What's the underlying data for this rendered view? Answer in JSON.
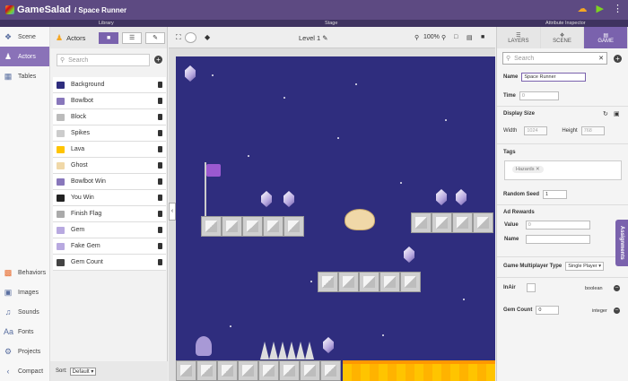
{
  "app": {
    "name": "GameSalad",
    "project": "/ Space Runner"
  },
  "sections": {
    "library": "Library",
    "stage": "Stage",
    "inspector": "Attribute Inspector"
  },
  "nav": {
    "top": [
      {
        "label": "Scene"
      },
      {
        "label": "Actors"
      },
      {
        "label": "Tables"
      }
    ],
    "bottom": [
      {
        "label": "Behaviors"
      },
      {
        "label": "Images"
      },
      {
        "label": "Sounds"
      },
      {
        "label": "Fonts"
      },
      {
        "label": "Projects"
      },
      {
        "label": "Compact"
      }
    ]
  },
  "library": {
    "title": "Actors",
    "search_placeholder": "Search",
    "actors": [
      {
        "name": "Background",
        "color": "#2f2d7e"
      },
      {
        "name": "Bowlbot",
        "color": "#8877bb"
      },
      {
        "name": "Block",
        "color": "#bbbbbb"
      },
      {
        "name": "Spikes",
        "color": "#cccccc"
      },
      {
        "name": "Lava",
        "color": "#ffc400"
      },
      {
        "name": "Ghost",
        "color": "#f0d8a8"
      },
      {
        "name": "Bowlbot Win",
        "color": "#8877bb"
      },
      {
        "name": "You Win",
        "color": "#222222"
      },
      {
        "name": "Finish Flag",
        "color": "#aaaaaa"
      },
      {
        "name": "Gem",
        "color": "#b8a9e0"
      },
      {
        "name": "Fake Gem",
        "color": "#b8a9e0"
      },
      {
        "name": "Gem Count",
        "color": "#444444"
      }
    ],
    "sort_label": "Sort:",
    "sort_value": "Default"
  },
  "stage": {
    "level": "Level 1",
    "zoom": "100%"
  },
  "inspector": {
    "tabs": [
      "LAYERS",
      "SCENE",
      "GAME"
    ],
    "search_placeholder": "Search",
    "name_label": "Name",
    "name_value": "Space Runner",
    "time_label": "Time",
    "time_value": "0",
    "display_size_label": "Display Size",
    "width_label": "Width",
    "width_value": "1024",
    "height_label": "Height",
    "height_value": "768",
    "tags_label": "Tags",
    "tag_value": "Hazards",
    "seed_label": "Random Seed",
    "seed_value": "1",
    "ad_rewards_label": "Ad Rewards",
    "value_label": "Value",
    "value_value": "0",
    "ad_name_label": "Name",
    "multiplayer_label": "Game Multiplayer Type",
    "multiplayer_value": "Single Player",
    "attrs": [
      {
        "name": "InAir",
        "type": "boolean"
      },
      {
        "name": "Gem Count",
        "value": "0",
        "type": "integer"
      }
    ],
    "assignments": "Assignments"
  }
}
